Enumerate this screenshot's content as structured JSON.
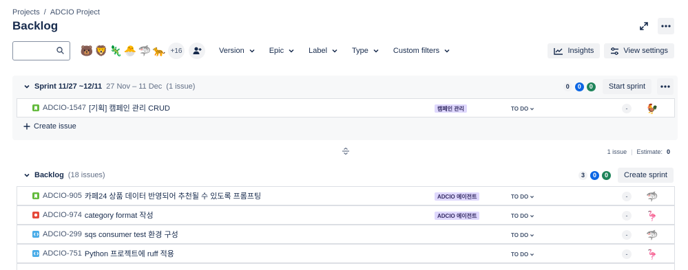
{
  "breadcrumb": {
    "projects": "Projects",
    "separator": "/",
    "project": "ADCIO Project"
  },
  "page_title": "Backlog",
  "top_actions": {
    "expand_icon": "expand-icon",
    "more_icon": "more-icon"
  },
  "toolbar": {
    "search_value": "",
    "search_icon": "search-icon",
    "avatars": [
      "🐻",
      "🦁",
      "🦎",
      "🐣",
      "🦈",
      "🐆"
    ],
    "avatars_more": "+16",
    "filters": [
      "Version",
      "Epic",
      "Label",
      "Type",
      "Custom filters"
    ],
    "insights_label": "Insights",
    "view_settings_label": "View settings"
  },
  "sprint": {
    "name": "Sprint 11/27 ~12/11",
    "dates": "27 Nov – 11 Dec",
    "count": "(1 issue)",
    "counts": {
      "todo": "0",
      "in_progress": "0",
      "done": "0"
    },
    "start_label": "Start sprint",
    "issues": [
      {
        "type": "story",
        "key": "ADCIO-1547",
        "summary": "[기획] 캠페인 관리 CRUD",
        "epic": "캠페인 관리",
        "status": "TO DO",
        "estimate": "-",
        "assignee": "🐓"
      }
    ],
    "create_issue_label": "Create issue"
  },
  "sprint_summary": {
    "issues": "1 issue",
    "sep": "|",
    "estimate_label": "Estimate:",
    "estimate_value": "0"
  },
  "backlog": {
    "name": "Backlog",
    "count": "(18 issues)",
    "counts": {
      "todo": "3",
      "in_progress": "0",
      "done": "0"
    },
    "create_sprint_label": "Create sprint",
    "issues": [
      {
        "type": "story",
        "key": "ADCIO-905",
        "summary": "카페24 상품 데이터 반영되어 추천될 수 있도록 프롬프팅",
        "epic": "ADCIO 에이전트",
        "status": "TO DO",
        "estimate": "-",
        "assignee": "🦈"
      },
      {
        "type": "bug",
        "key": "ADCIO-974",
        "summary": "category format 작성",
        "epic": "ADCIO 에이전트",
        "status": "TO DO",
        "estimate": "-",
        "assignee": "🦩"
      },
      {
        "type": "task",
        "key": "ADCIO-299",
        "summary": "sqs consumer test 환경 구성",
        "epic": "",
        "status": "TO DO",
        "estimate": "-",
        "assignee": "🦈"
      },
      {
        "type": "task",
        "key": "ADCIO-751",
        "summary": "Python 프로젝트에 ruff 적용",
        "epic": "",
        "status": "TO DO",
        "estimate": "-",
        "assignee": "🦩"
      }
    ]
  }
}
